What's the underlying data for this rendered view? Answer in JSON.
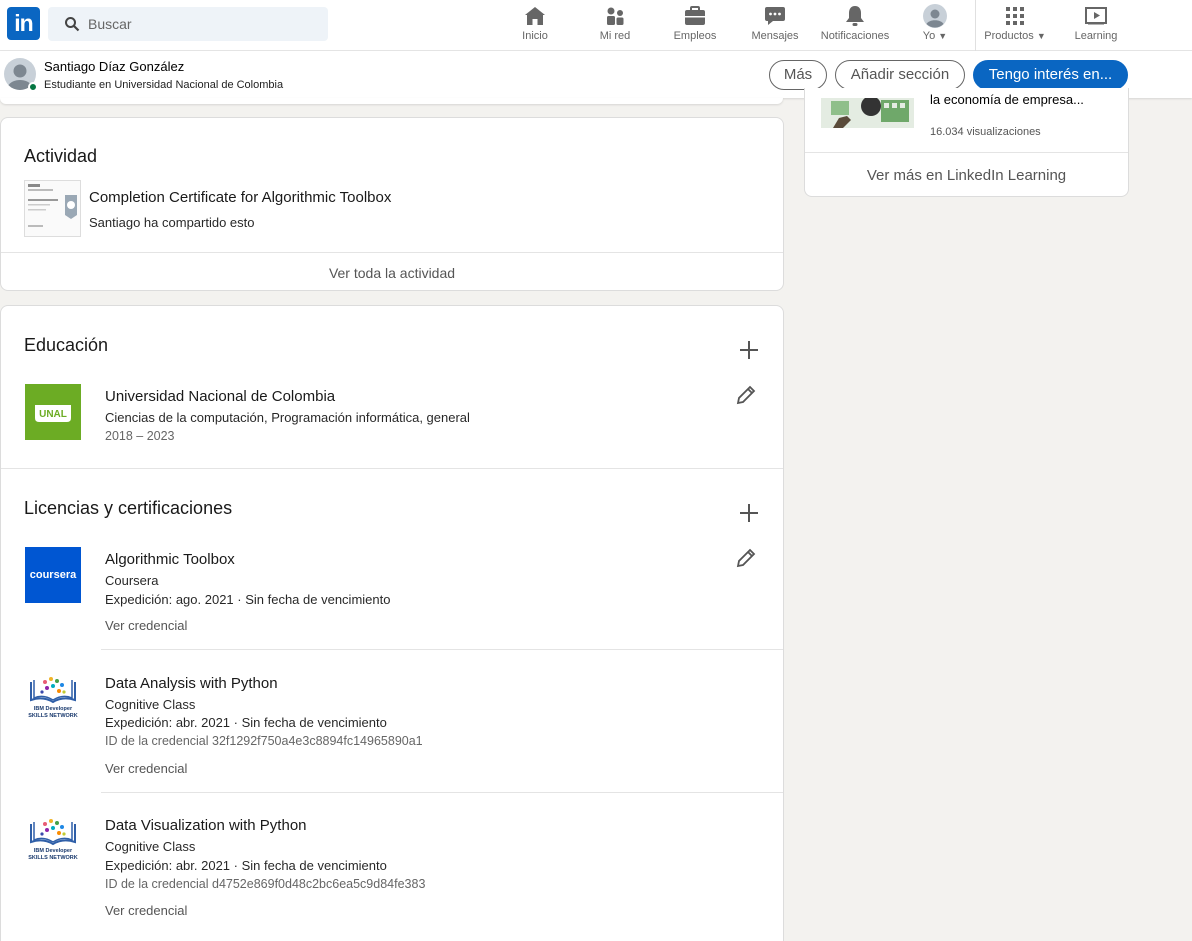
{
  "nav": {
    "search_placeholder": "Buscar",
    "items": [
      {
        "label": "Inicio",
        "icon": "home-icon"
      },
      {
        "label": "Mi red",
        "icon": "network-icon"
      },
      {
        "label": "Empleos",
        "icon": "briefcase-icon"
      },
      {
        "label": "Mensajes",
        "icon": "messaging-icon"
      },
      {
        "label": "Notificaciones",
        "icon": "bell-icon"
      },
      {
        "label": "Yo",
        "icon": "avatar"
      },
      {
        "label": "Productos",
        "icon": "grid-icon"
      },
      {
        "label": "Learning",
        "icon": "learning-icon"
      }
    ]
  },
  "profile_bar": {
    "name": "Santiago Díaz González",
    "headline": "Estudiante en Universidad Nacional de Colombia",
    "more_label": "Más",
    "add_section_label": "Añadir sección",
    "open_to_label": "Tengo interés en..."
  },
  "activity": {
    "title": "Actividad",
    "post_title": "Completion Certificate for Algorithmic Toolbox",
    "post_sub": "Santiago ha compartido esto",
    "see_all": "Ver toda la actividad"
  },
  "education": {
    "title": "Educación",
    "items": [
      {
        "school": "Universidad Nacional de Colombia",
        "degree": "Ciencias de la computación, Programación informática, general",
        "dates": "2018 – 2023",
        "logo_text": "UNAL"
      }
    ]
  },
  "licenses": {
    "title": "Licencias y certificaciones",
    "items": [
      {
        "name": "Algorithmic Toolbox",
        "issuer": "Coursera",
        "issued": "Expedición: ago. 2021 · Sin fecha de vencimiento",
        "credential_id": "",
        "link": "Ver credencial",
        "logo_text": "coursera"
      },
      {
        "name": "Data Analysis with Python",
        "issuer": "Cognitive Class",
        "issued": "Expedición: abr. 2021 · Sin fecha de vencimiento",
        "credential_id": "ID de la credencial 32f1292f750a4e3c8894fc14965890a1",
        "link": "Ver credencial",
        "logo_text": "IBM Developer SKILLS NETWORK"
      },
      {
        "name": "Data Visualization with Python",
        "issuer": "Cognitive Class",
        "issued": "Expedición: abr. 2021 · Sin fecha de vencimiento",
        "credential_id": "ID de la credencial d4752e869f0d48c2bc6ea5c9d84fe383",
        "link": "Ver credencial",
        "logo_text": "IBM Developer SKILLS NETWORK"
      }
    ]
  },
  "learning_rail": {
    "course_title": "la economía de empresa...",
    "views": "16.034 visualizaciones",
    "see_more": "Ver más en LinkedIn Learning"
  },
  "colors": {
    "brand": "#0a66c2",
    "unal_green": "#6cac24",
    "coursera_blue": "#0056d2",
    "online_green": "#057642"
  }
}
